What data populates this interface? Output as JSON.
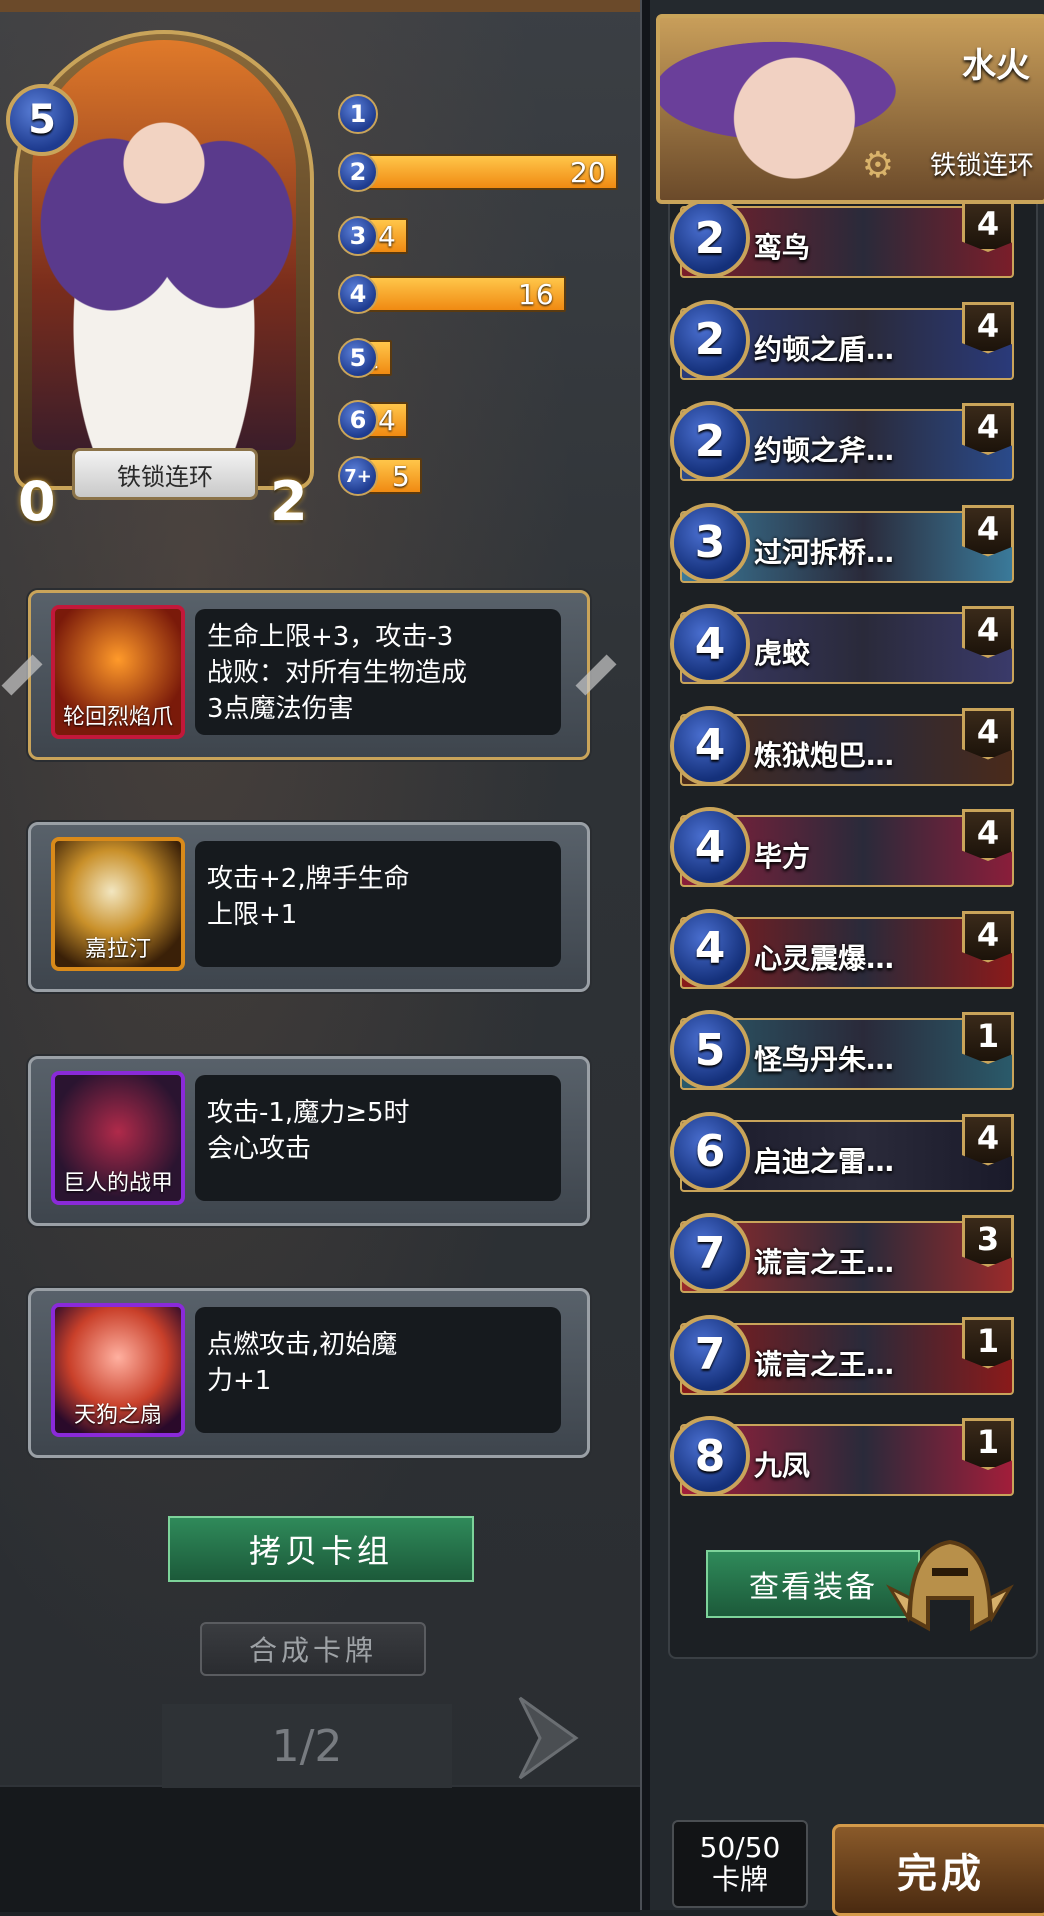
{
  "hero": {
    "cost": "5",
    "name": "铁锁连环",
    "attack": "0",
    "health": "2"
  },
  "cost_bars": [
    {
      "cost": "1",
      "value": 0
    },
    {
      "cost": "2",
      "value": 20
    },
    {
      "cost": "3",
      "value": 4
    },
    {
      "cost": "4",
      "value": 16
    },
    {
      "cost": "5",
      "value": 1
    },
    {
      "cost": "6",
      "value": 4
    },
    {
      "cost": "7+",
      "value": 5
    }
  ],
  "equipment": [
    {
      "name": "轮回烈焰爪",
      "desc_lines": [
        "生命上限+3，攻击-3",
        "战败：对所有生物造成",
        "3点魔法伤害"
      ],
      "color": "#c2183a"
    },
    {
      "name": "嘉拉汀",
      "desc_lines": [
        "攻击+2,牌手生命",
        "上限+1"
      ],
      "color": "#d98a1a"
    },
    {
      "name": "巨人的战甲",
      "desc_lines": [
        "攻击-1,魔力≥5时",
        "会心攻击"
      ],
      "color": "#8a2ad9"
    },
    {
      "name": "天狗之扇",
      "desc_lines": [
        "点燃攻击,初始魔",
        "力+1"
      ],
      "color": "#8a2ad9"
    }
  ],
  "buttons": {
    "copy_deck": "拷贝卡组",
    "synthesize": "合成卡牌",
    "page": "1/2",
    "view_equipment": "查看装备",
    "done": "完成"
  },
  "deck": {
    "title": "水火",
    "skill": "铁锁连环",
    "count_value": "50/50",
    "count_label": "卡牌",
    "cards": [
      {
        "cost": "2",
        "name": "鸾鸟",
        "count": "4",
        "color": "#7a1e2a"
      },
      {
        "cost": "2",
        "name": "约顿之盾…",
        "count": "4",
        "color": "#2a3a7a"
      },
      {
        "cost": "2",
        "name": "约顿之斧…",
        "count": "4",
        "color": "#2a4a8a"
      },
      {
        "cost": "3",
        "name": "过河拆桥…",
        "count": "4",
        "color": "#3a7a9a"
      },
      {
        "cost": "4",
        "name": "虎蛟",
        "count": "4",
        "color": "#3a3a6a"
      },
      {
        "cost": "4",
        "name": "炼狱炮巴…",
        "count": "4",
        "color": "#4a2a1a"
      },
      {
        "cost": "4",
        "name": "毕方",
        "count": "4",
        "color": "#8a1e3a"
      },
      {
        "cost": "4",
        "name": "心灵震爆…",
        "count": "4",
        "color": "#8a1a1a"
      },
      {
        "cost": "5",
        "name": "怪鸟丹朱…",
        "count": "1",
        "color": "#2a5a6a"
      },
      {
        "cost": "6",
        "name": "启迪之雷…",
        "count": "4",
        "color": "#1a1a2a"
      },
      {
        "cost": "7",
        "name": "谎言之王…",
        "count": "3",
        "color": "#9a2a2a"
      },
      {
        "cost": "7",
        "name": "谎言之王…",
        "count": "1",
        "color": "#8a1a1a"
      },
      {
        "cost": "8",
        "name": "九凤",
        "count": "1",
        "color": "#a21e3a"
      }
    ]
  }
}
